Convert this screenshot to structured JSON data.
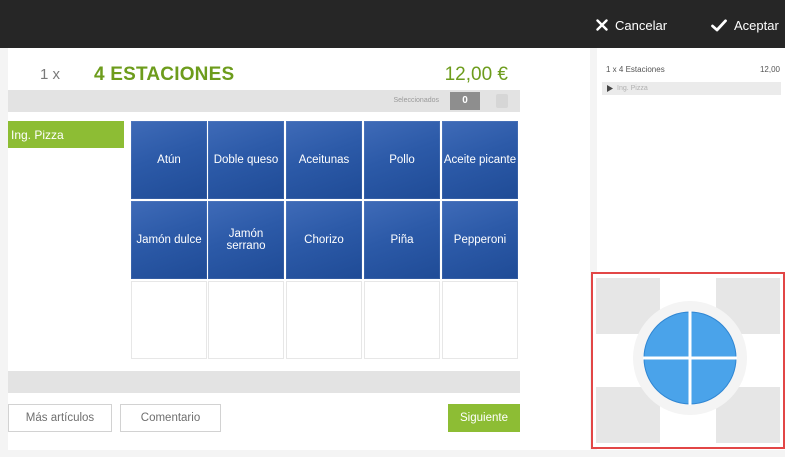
{
  "topbar": {
    "cancel_label": "Cancelar",
    "accept_label": "Aceptar"
  },
  "product": {
    "quantity": "1 x",
    "name": "4 ESTACIONES",
    "price": "12,00 €"
  },
  "selection": {
    "label": "Seleccionados",
    "count": "0"
  },
  "category": {
    "label": "Ing. Pizza"
  },
  "ingredients": [
    [
      "Atún",
      "Doble queso",
      "Aceitunas",
      "Pollo",
      "Aceite picante"
    ],
    [
      "Jamón dulce",
      "Jamón serrano",
      "Chorizo",
      "Piña",
      "Pepperoni"
    ]
  ],
  "buttons": {
    "more_items": "Más artículos",
    "comment": "Comentario",
    "next": "Siguiente"
  },
  "summary": {
    "line_label": "1 x 4 Estaciones",
    "line_price": "12,00",
    "sub_label": "Ing. Pizza"
  },
  "colors": {
    "accent_green": "#8dbd34",
    "tile_blue": "#2c5aa8",
    "highlight_red": "#e24646",
    "pie_blue": "#4aa3ea"
  },
  "icons": {
    "cancel": "x-icon",
    "accept": "check-icon",
    "selection_clear": "trash-icon",
    "pizza_portions": "pizza-quarters-icon"
  }
}
